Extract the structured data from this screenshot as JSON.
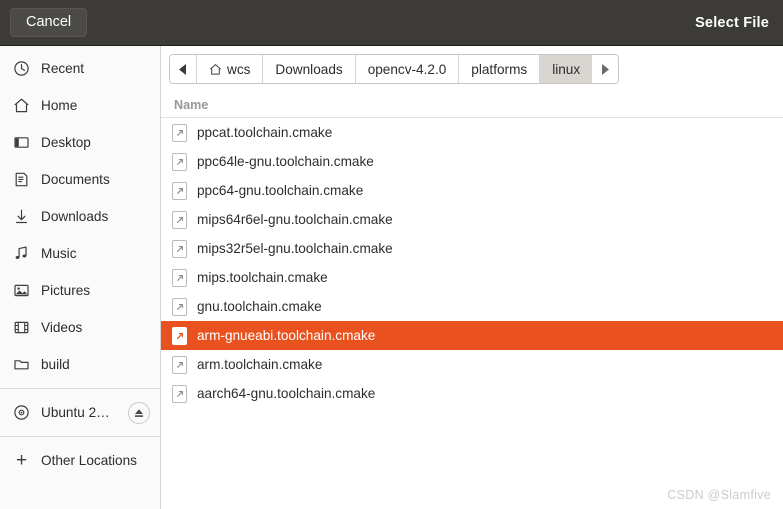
{
  "header": {
    "cancel_label": "Cancel",
    "title": "Select File"
  },
  "sidebar": {
    "items": [
      {
        "label": "Recent",
        "icon": "clock-icon"
      },
      {
        "label": "Home",
        "icon": "home-icon"
      },
      {
        "label": "Desktop",
        "icon": "desktop-icon"
      },
      {
        "label": "Documents",
        "icon": "documents-icon"
      },
      {
        "label": "Downloads",
        "icon": "download-icon"
      },
      {
        "label": "Music",
        "icon": "music-note-icon"
      },
      {
        "label": "Pictures",
        "icon": "image-icon"
      },
      {
        "label": "Videos",
        "icon": "film-icon"
      },
      {
        "label": "build",
        "icon": "folder-icon"
      }
    ],
    "devices": [
      {
        "label": "Ubuntu 2…",
        "icon": "disc-icon",
        "eject_icon": "eject-icon"
      }
    ],
    "other_locations": {
      "label": "Other Locations",
      "icon": "plus-icon"
    }
  },
  "pathbar": {
    "back_icon": "chevron-left-icon",
    "forward_icon": "chevron-right-icon",
    "crumbs": [
      {
        "label": "wcs",
        "icon": "home-icon",
        "active": false
      },
      {
        "label": "Downloads",
        "icon": "",
        "active": false
      },
      {
        "label": "opencv-4.2.0",
        "icon": "",
        "active": false
      },
      {
        "label": "platforms",
        "icon": "",
        "active": false
      },
      {
        "label": "linux",
        "icon": "",
        "active": true
      }
    ]
  },
  "filelist": {
    "column_header": "Name",
    "rows": [
      {
        "name": "ppcat.toolchain.cmake",
        "selected": false
      },
      {
        "name": "ppc64le-gnu.toolchain.cmake",
        "selected": false
      },
      {
        "name": "ppc64-gnu.toolchain.cmake",
        "selected": false
      },
      {
        "name": "mips64r6el-gnu.toolchain.cmake",
        "selected": false
      },
      {
        "name": "mips32r5el-gnu.toolchain.cmake",
        "selected": false
      },
      {
        "name": "mips.toolchain.cmake",
        "selected": false
      },
      {
        "name": "gnu.toolchain.cmake",
        "selected": false
      },
      {
        "name": "arm-gnueabi.toolchain.cmake",
        "selected": true
      },
      {
        "name": "arm.toolchain.cmake",
        "selected": false
      },
      {
        "name": "aarch64-gnu.toolchain.cmake",
        "selected": false
      }
    ]
  },
  "watermark": "CSDN @Slamfive",
  "colors": {
    "selection": "#e9521f",
    "titlebar": "#3c3b37",
    "sidebar": "#fafafa"
  }
}
